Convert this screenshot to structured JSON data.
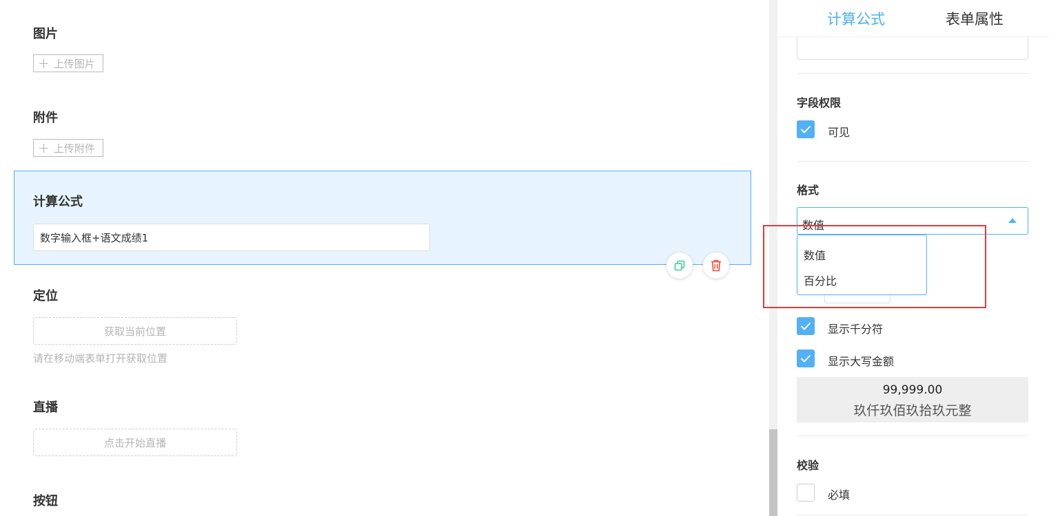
{
  "canvas": {
    "fields": {
      "image": {
        "label": "图片",
        "upload_label": "上传图片"
      },
      "attachment": {
        "label": "附件",
        "upload_label": "上传附件"
      },
      "formula": {
        "label": "计算公式",
        "value": "数字输入框+语文成绩1"
      },
      "location": {
        "label": "定位",
        "button_label": "获取当前位置",
        "hint": "请在移动端表单打开获取位置"
      },
      "live": {
        "label": "直播",
        "button_label": "点击开始直播"
      },
      "button": {
        "label": "按钮"
      }
    },
    "selected_actions": {
      "copy_icon": "copy-icon",
      "delete_icon": "trash-icon"
    }
  },
  "panel": {
    "tabs": [
      {
        "label": "计算公式",
        "active": true
      },
      {
        "label": "表单属性",
        "active": false
      }
    ],
    "permissions": {
      "title": "字段权限",
      "visible": {
        "label": "可见",
        "checked": true
      }
    },
    "format": {
      "title": "格式",
      "selected": "数值",
      "options": [
        "数值",
        "百分比"
      ],
      "thousands_separator": {
        "label": "显示千分符",
        "checked": true
      },
      "uppercase_amount": {
        "label": "显示大写金额",
        "checked": true
      },
      "preview_number": "99,999.00",
      "preview_uppercase": "玖仟玖佰玖拾玖元整"
    },
    "validation": {
      "title": "校验",
      "required": {
        "label": "必填",
        "checked": false
      }
    }
  },
  "colors": {
    "accent": "#52b0f5",
    "tab_active": "#4ab0f2",
    "selected_bg": "#e8f4fd",
    "delete_red": "#e74c3c",
    "copy_green": "#3ec89b",
    "highlight_red": "#e53935"
  }
}
